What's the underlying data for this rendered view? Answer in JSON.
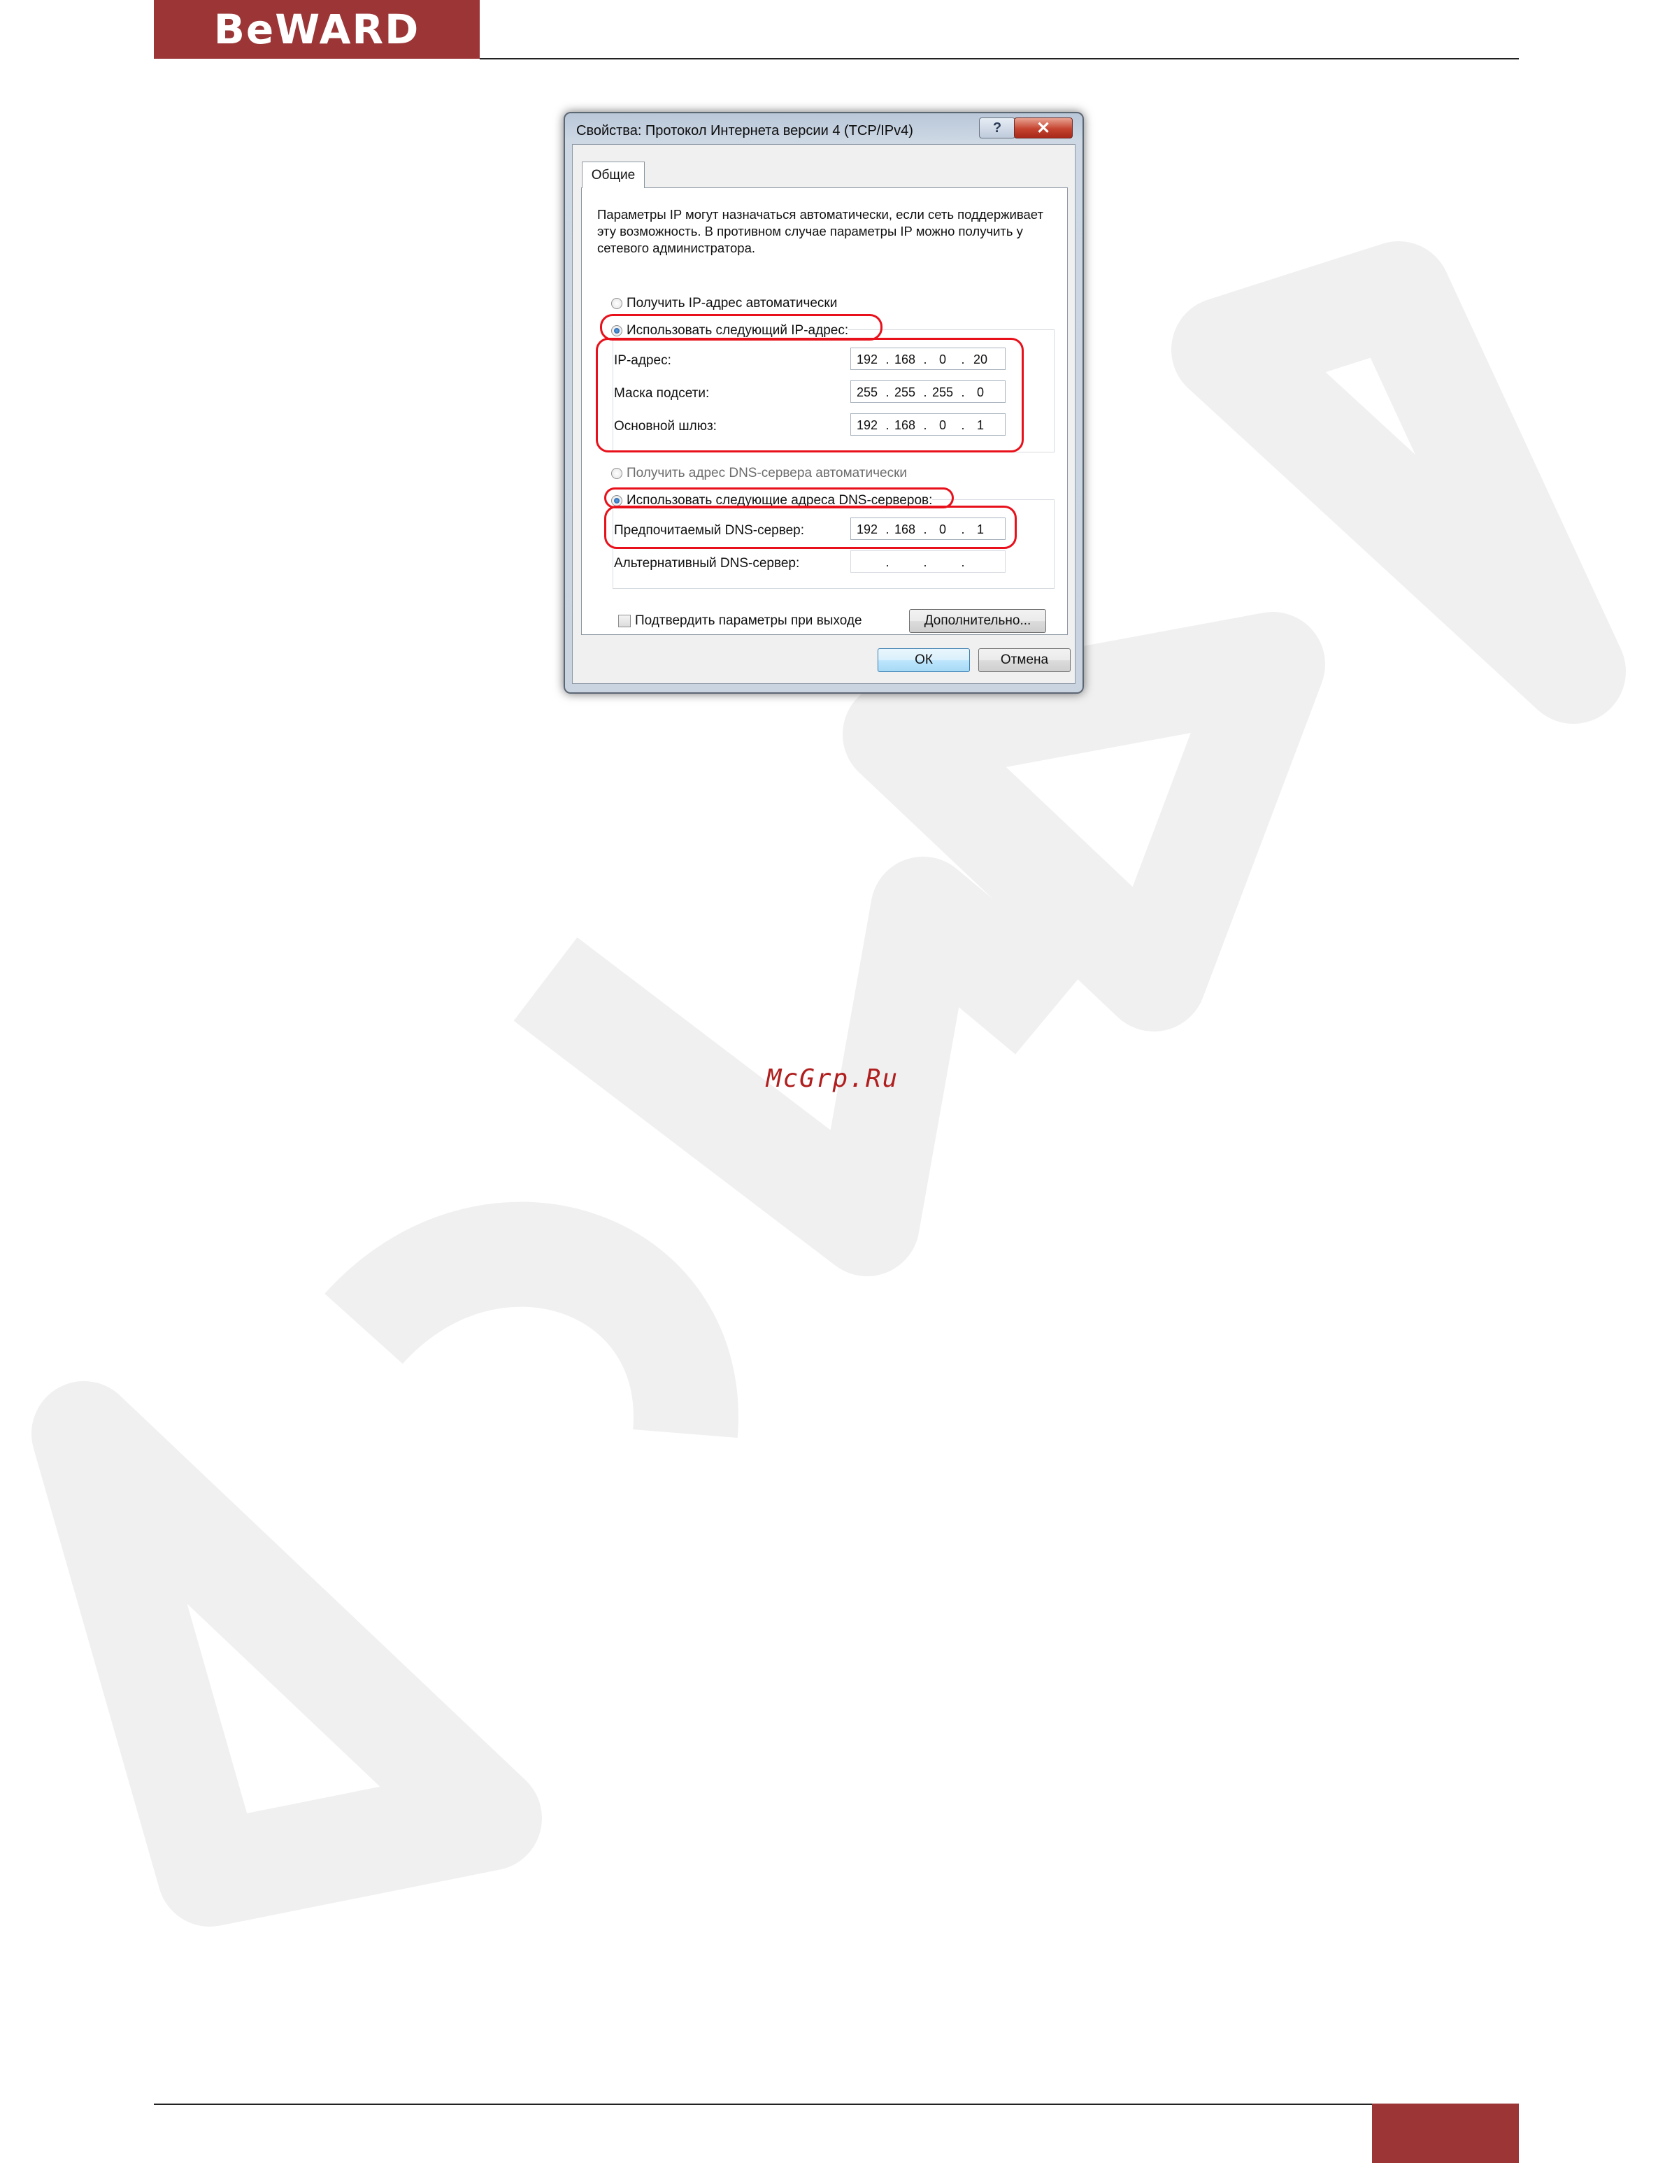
{
  "brand": {
    "logo_text": "BeWARD",
    "accent_color": "#9b3536"
  },
  "watermark_link": "McGrp.Ru",
  "dialog": {
    "title": "Свойства: Протокол Интернета версии 4 (TCP/IPv4)",
    "help_label": "?",
    "close_label": "✕",
    "tab_label": "Общие",
    "description": "Параметры IP могут назначаться автоматически, если сеть поддерживает эту возможность. В противном случае параметры IP можно получить у сетевого администратора.",
    "ip_auto_label": "Получить IP-адрес автоматически",
    "ip_manual_label": "Использовать следующий IP-адрес:",
    "ip_fields": [
      {
        "label": "IP-адрес:",
        "octets": [
          "192",
          "168",
          "0",
          "20"
        ]
      },
      {
        "label": "Маска подсети:",
        "octets": [
          "255",
          "255",
          "255",
          "0"
        ]
      },
      {
        "label": "Основной шлюз:",
        "octets": [
          "192",
          "168",
          "0",
          "1"
        ]
      }
    ],
    "dns_auto_label": "Получить адрес DNS-сервера автоматически",
    "dns_manual_label": "Использовать следующие адреса DNS-серверов:",
    "dns_fields": [
      {
        "label": "Предпочитаемый DNS-сервер:",
        "octets": [
          "192",
          "168",
          "0",
          "1"
        ]
      },
      {
        "label": "Альтернативный DNS-сервер:",
        "octets": [
          "",
          "",
          "",
          ""
        ]
      }
    ],
    "validate_label": "Подтвердить параметры при выходе",
    "advanced_label": "Дополнительно...",
    "ok_label": "ОК",
    "cancel_label": "Отмена",
    "highlight_color": "#e8101a"
  }
}
